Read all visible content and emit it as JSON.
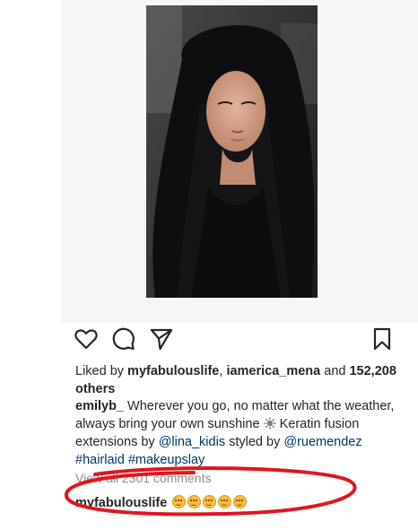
{
  "post": {
    "image_alt": "selfie"
  },
  "actions": {
    "like_icon": "heart-icon",
    "comment_icon": "comment-icon",
    "share_icon": "share-icon",
    "save_icon": "bookmark-icon"
  },
  "likes": {
    "prefix": "Liked by ",
    "user1": "myfabulouslife",
    "sep": ", ",
    "user2": "iamerica_mena",
    "and": " and ",
    "count": "152,208",
    "others": "others"
  },
  "caption": {
    "username": "emilyb_",
    "text1": " Wherever you go, no matter what the weather, always bring your own sunshine ",
    "text2": " Keratin fusion extensions by ",
    "mention1": "@lina_kidis",
    "text3": " styled by ",
    "mention2": "@ruemendez",
    "tag1": "#hairlaid",
    "tag2": "#makeupslay"
  },
  "view_all": "View all 2301 comments",
  "comment": {
    "username": "myfabulouslife"
  },
  "colors": {
    "highlight": "#e0161e",
    "link": "#003569",
    "muted": "#8e8e8e"
  }
}
